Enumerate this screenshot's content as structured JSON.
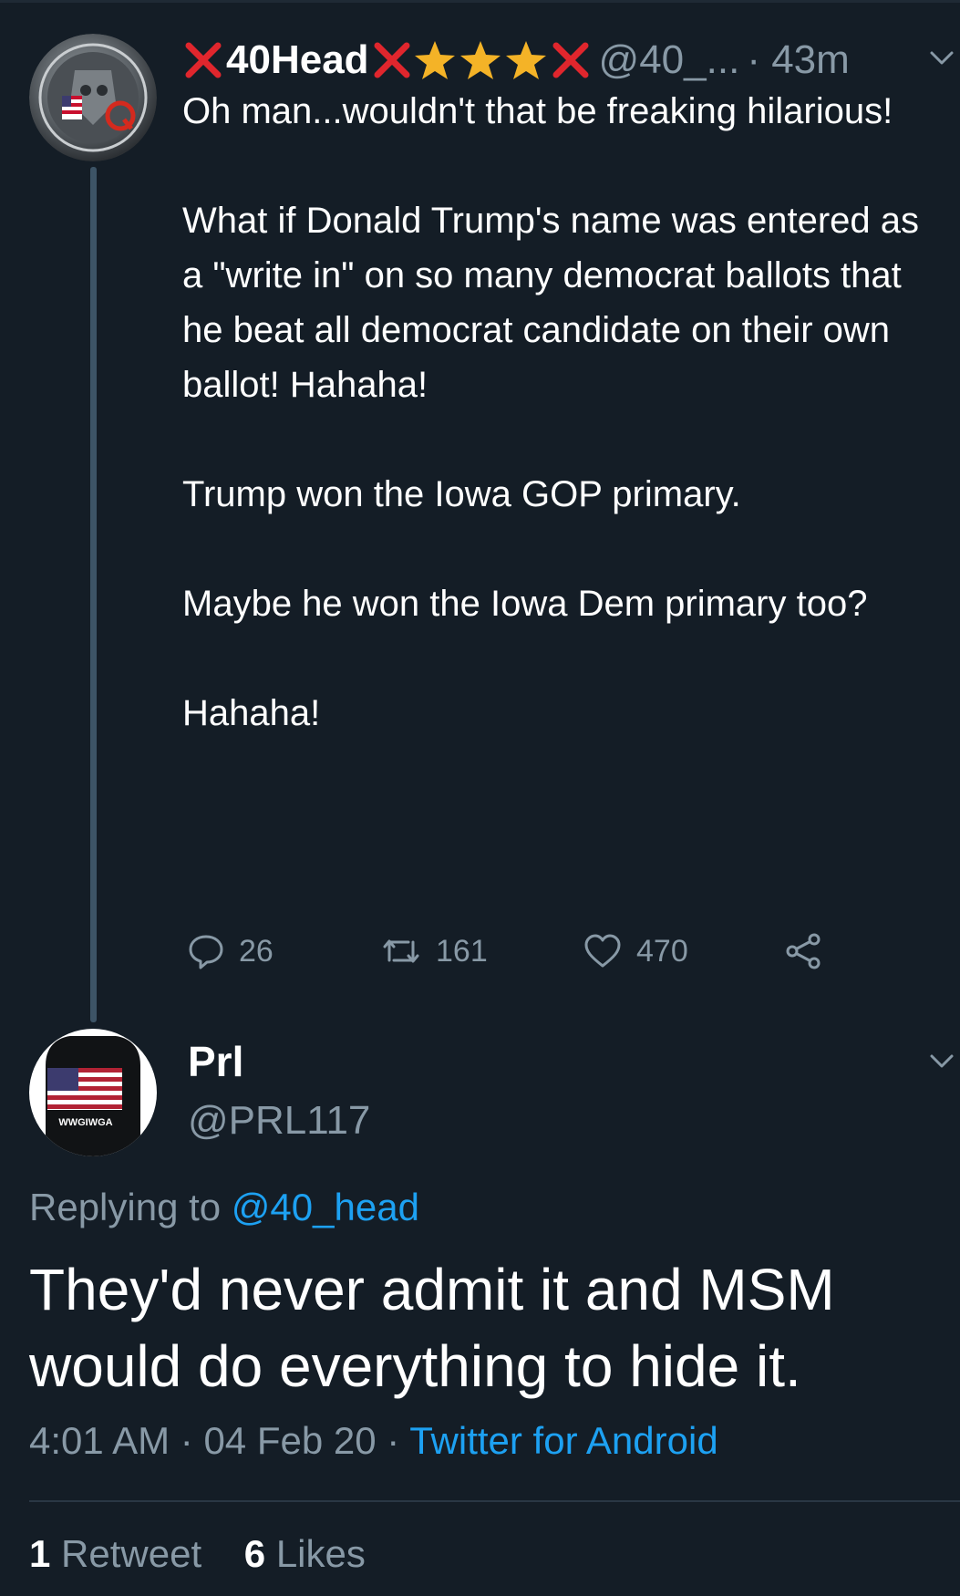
{
  "tweet": {
    "author_name": "40Head",
    "handle": "@40_...",
    "time": "· 43m",
    "paragraphs": [
      "Oh man...wouldn't that be freaking hilarious!",
      "What if Donald Trump's name was entered as a \"write in\" on so many democrat ballots that he beat all democrat candidate on their own ballot! Hahaha!",
      "Trump won the Iowa GOP primary.",
      "Maybe he won the Iowa Dem primary too?",
      "Hahaha!"
    ],
    "reply_count": "26",
    "retweet_count": "161",
    "like_count": "470"
  },
  "reply": {
    "author_name": "Prl",
    "handle": "@PRL117",
    "avatar_text": "WWGIWGA",
    "replying_prefix": "Replying to",
    "replying_to": "@40_head",
    "text": "They'd never admit it and MSM would do everything to hide it.",
    "time": "4:01 AM",
    "date": "04 Feb 20",
    "source": "Twitter for Android",
    "retweets_count": "1",
    "retweets_label": "Retweet",
    "likes_count": "6",
    "likes_label": "Likes"
  },
  "colors": {
    "background": "#141d26",
    "secondary_text": "#8899a6",
    "link": "#1da1f2",
    "emoji_x": "#e0262d",
    "emoji_star": "#f4b327"
  }
}
